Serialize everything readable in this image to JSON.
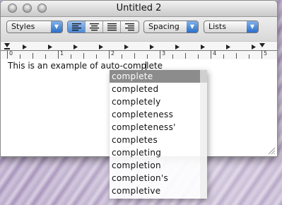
{
  "window": {
    "title": "Untitled 2"
  },
  "toolbar": {
    "styles_label": "Styles",
    "spacing_label": "Spacing",
    "lists_label": "Lists",
    "alignment_options": [
      "align-left",
      "align-center",
      "justify",
      "align-right"
    ],
    "selected_alignment": "align-left"
  },
  "ruler": {
    "numbers": [
      "0",
      "1",
      "2",
      "3",
      "4",
      "5"
    ]
  },
  "document": {
    "text": "This is an example of auto-complete"
  },
  "autocomplete": {
    "selected": "complete",
    "items": [
      "complete",
      "completed",
      "completely",
      "completeness",
      "completeness'",
      "completes",
      "completing",
      "completion",
      "completion's",
      "completive"
    ]
  }
}
